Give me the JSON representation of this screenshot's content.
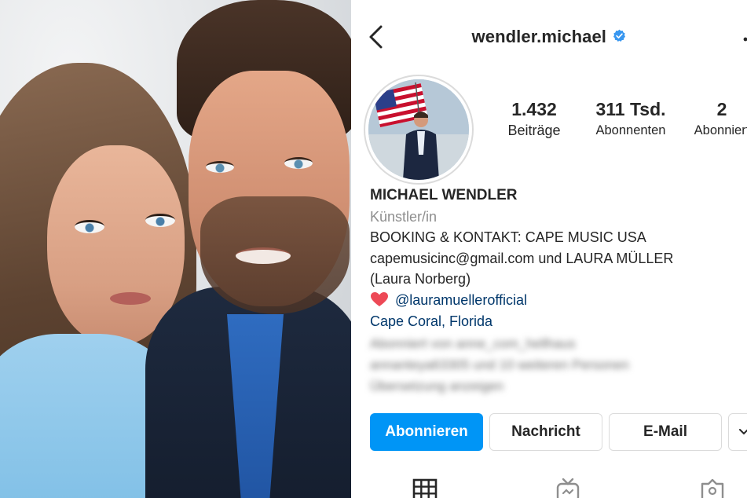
{
  "profile": {
    "username": "wendler.michael",
    "verified": true,
    "stats": [
      {
        "value": "1.432",
        "label": "Beiträge"
      },
      {
        "value": "311 Tsd.",
        "label": "Abonnenten"
      },
      {
        "value": "2",
        "label": "Abonniert"
      }
    ],
    "bio": {
      "name": "MICHAEL WENDLER",
      "category": "Künstler/in",
      "line1": "BOOKING & KONTAKT: CAPE MUSIC USA",
      "line2": "capemusicinc@gmail.com und LAURA MÜLLER",
      "line3": "(Laura Norberg)",
      "mention": "@lauramuellerofficial",
      "location": "Cape Coral, Florida"
    },
    "buttons": {
      "follow": "Abonnieren",
      "message": "Nachricht",
      "email": "E-Mail"
    }
  },
  "colors": {
    "accent": "#0095f6",
    "link": "#00376b",
    "verified": "#3897f0",
    "heart": "#ed4956"
  },
  "icons": [
    "back-icon",
    "verified-icon",
    "more-icon",
    "heart-icon",
    "chevron-down-icon",
    "grid-icon",
    "igtv-icon",
    "tagged-icon"
  ]
}
